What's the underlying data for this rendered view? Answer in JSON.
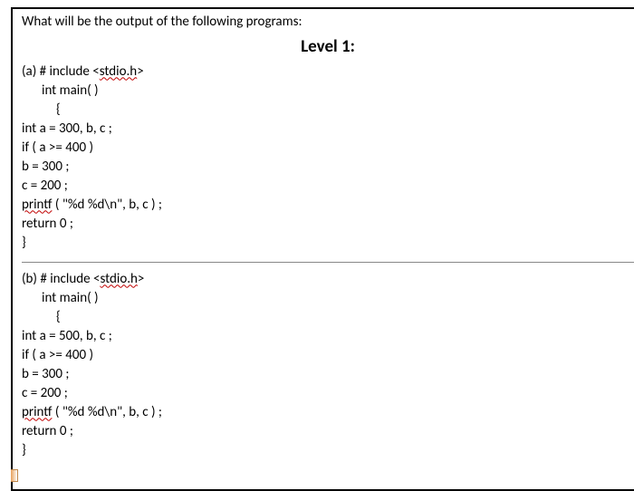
{
  "question": "What will be the output of the following programs:",
  "level_header": "Level 1:",
  "program_a": {
    "label": "(a) # include <",
    "wavy1": "stdio.h",
    "after_wavy1": ">",
    "line2": "int main( )",
    "line3": "{",
    "line4": "int a = 300, b, c ;",
    "line5": "if ( a >= 400 )",
    "line6": "b = 300 ;",
    "line7": "c = 200 ;",
    "wavy2": "printf",
    "line8_after": " ( \"%d %d\\n\", b, c ) ;",
    "line9": "return 0 ;",
    "line10": "}"
  },
  "program_b": {
    "label": "(b) # include <",
    "wavy1": "stdio.h",
    "after_wavy1": ">",
    "line2": "int main( )",
    "line3": "{",
    "line4": "int a = 500, b, c ;",
    "line5": "if ( a >= 400 )",
    "line6": "b = 300 ;",
    "line7": "c = 200 ;",
    "wavy2": "printf",
    "line8_after": " ( \"%d %d\\n\", b, c ) ;",
    "line9": "return 0 ;",
    "line10": "}"
  }
}
